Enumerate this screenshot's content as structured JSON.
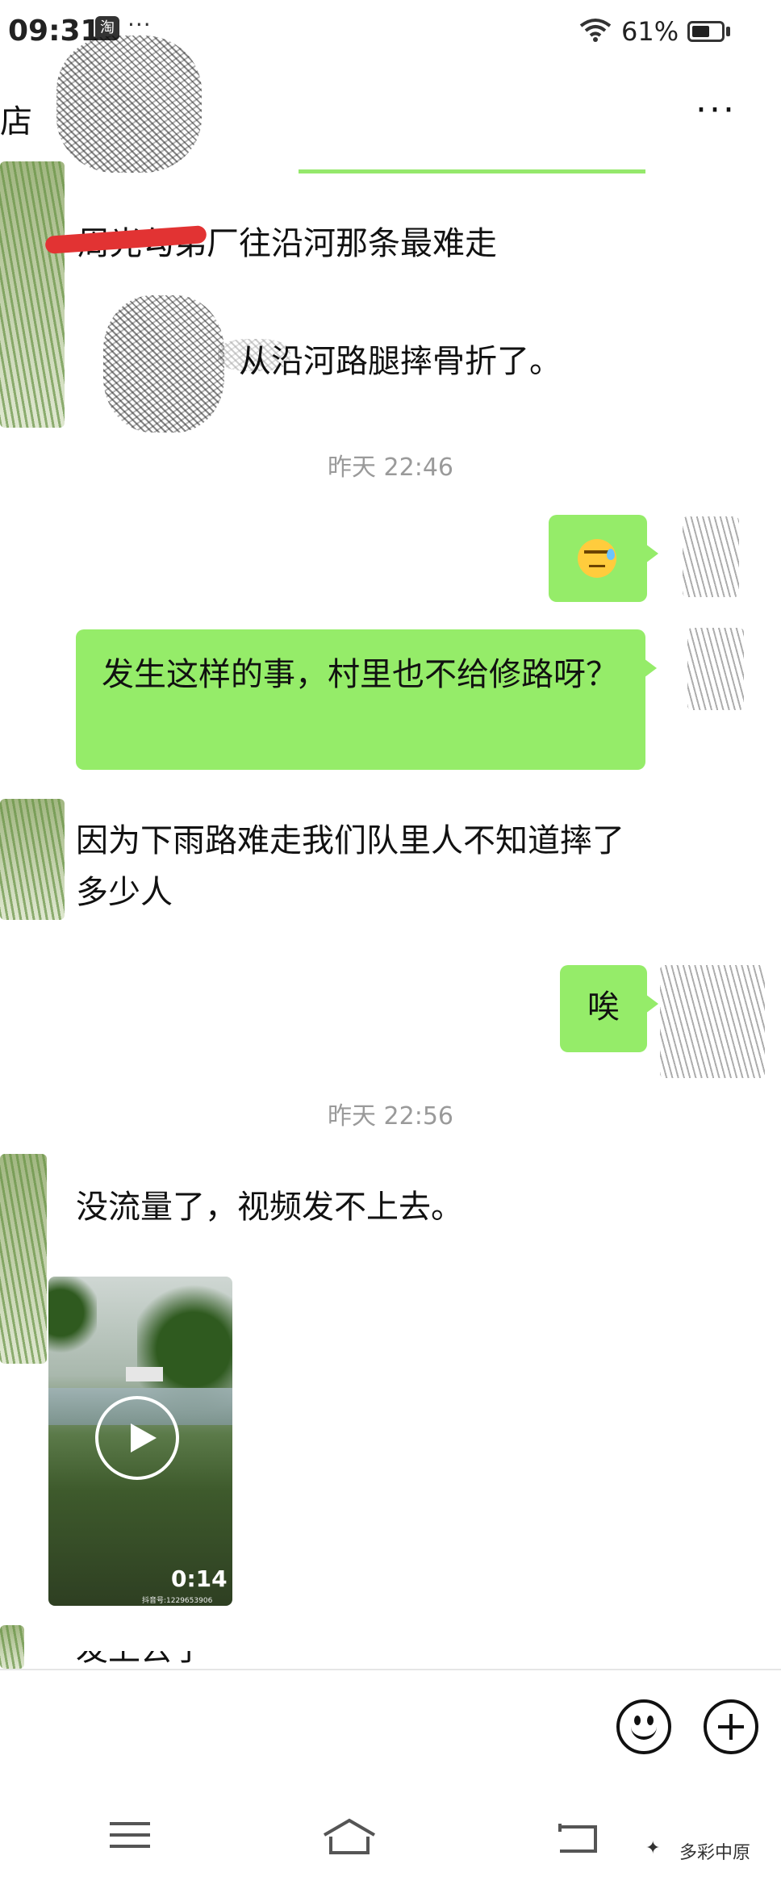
{
  "status_bar": {
    "time": "09:31",
    "app_badge": "淘",
    "dots": "···",
    "battery_percent": "61%",
    "battery_level": 0.61
  },
  "header": {
    "title": "店",
    "more_label": "···"
  },
  "messages": [
    {
      "side": "in",
      "text": "周光勾弟厂往沿河那条最难走"
    },
    {
      "side": "in",
      "text": "从沿河路腿摔骨折了。"
    },
    {
      "type": "time",
      "text": "昨天 22:46"
    },
    {
      "side": "out",
      "emoji": "sweat-smile"
    },
    {
      "side": "out",
      "text": "发生这样的事，村里也不给修路呀？"
    },
    {
      "side": "in",
      "text": "因为下雨路难走我们队里人不知道摔了多少人"
    },
    {
      "side": "out",
      "text": "唉"
    },
    {
      "type": "time",
      "text": "昨天 22:56"
    },
    {
      "side": "in",
      "text": "没流量了，视频发不上去。"
    },
    {
      "side": "in",
      "type": "video",
      "duration": "0:14",
      "watermark": "抖音号:1229653906"
    },
    {
      "side": "in",
      "text": "发上去了"
    }
  ],
  "nav": {
    "watermark": "多彩中原"
  }
}
